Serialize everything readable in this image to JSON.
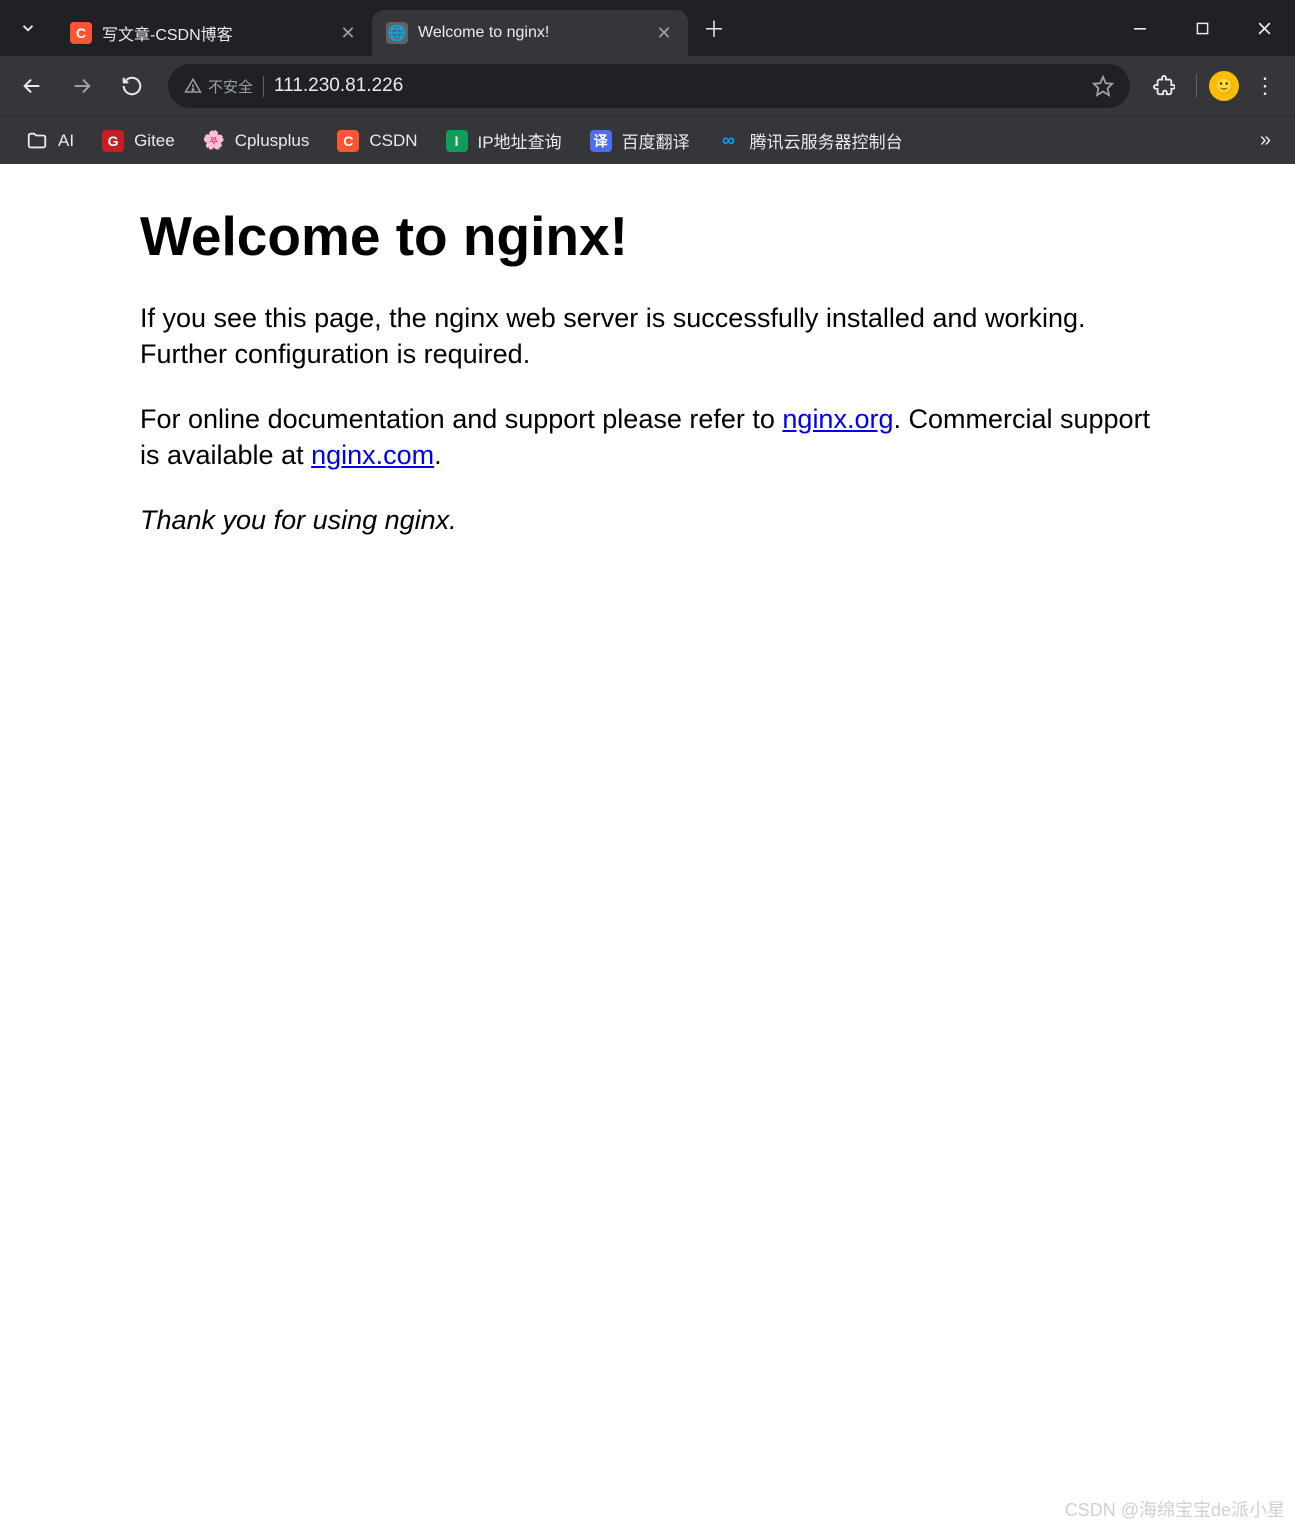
{
  "tabs": [
    {
      "title": "写文章-CSDN博客",
      "favicon_letter": "C",
      "favicon_bg": "#fc5531",
      "favicon_fg": "#fff",
      "active": false
    },
    {
      "title": "Welcome to nginx!",
      "favicon_letter": "🌐",
      "favicon_bg": "#5f6368",
      "favicon_fg": "#e8eaed",
      "active": true
    }
  ],
  "addressbar": {
    "security_label": "不安全",
    "url": "111.230.81.226"
  },
  "bookmarks": [
    {
      "label": "AI",
      "icon_type": "folder",
      "icon_bg": "",
      "icon_fg": "#e8eaed",
      "icon_text": ""
    },
    {
      "label": "Gitee",
      "icon_type": "square",
      "icon_bg": "#c71d23",
      "icon_fg": "#fff",
      "icon_text": "G"
    },
    {
      "label": "Cplusplus",
      "icon_type": "emoji",
      "icon_bg": "",
      "icon_fg": "",
      "icon_text": "🌸"
    },
    {
      "label": "CSDN",
      "icon_type": "square",
      "icon_bg": "#fc5531",
      "icon_fg": "#fff",
      "icon_text": "C"
    },
    {
      "label": "IP地址查询",
      "icon_type": "square",
      "icon_bg": "#0f9d58",
      "icon_fg": "#fff",
      "icon_text": "I"
    },
    {
      "label": "百度翻译",
      "icon_type": "square",
      "icon_bg": "#4e6ef2",
      "icon_fg": "#fff",
      "icon_text": "译"
    },
    {
      "label": "腾讯云服务器控制台",
      "icon_type": "emoji",
      "icon_bg": "",
      "icon_fg": "#00a4ff",
      "icon_text": "∞"
    }
  ],
  "page": {
    "heading": "Welcome to nginx!",
    "para1": "If you see this page, the nginx web server is successfully installed and working. Further configuration is required.",
    "para2_pre": "For online documentation and support please refer to ",
    "link1": "nginx.org",
    "para2_mid": ". Commercial support is available at ",
    "link2": "nginx.com",
    "para2_post": ".",
    "thanks": "Thank you for using nginx."
  },
  "watermark": "CSDN @海绵宝宝de派小星"
}
